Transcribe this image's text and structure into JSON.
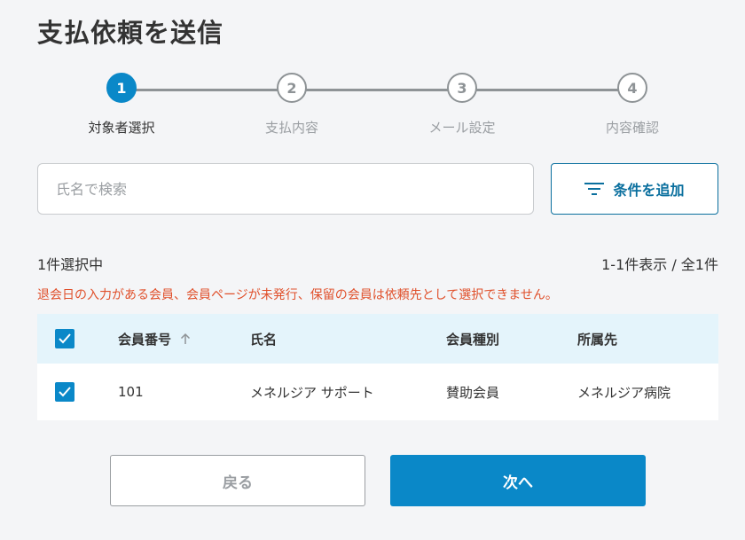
{
  "header": {
    "title": "支払依頼を送信"
  },
  "stepper": {
    "steps": [
      {
        "number": "1",
        "label": "対象者選択",
        "active": true
      },
      {
        "number": "2",
        "label": "支払内容",
        "active": false
      },
      {
        "number": "3",
        "label": "メール設定",
        "active": false
      },
      {
        "number": "4",
        "label": "内容確認",
        "active": false
      }
    ]
  },
  "search": {
    "placeholder": "氏名で検索",
    "value": ""
  },
  "filter": {
    "label": "条件を追加",
    "icon": "filter-icon"
  },
  "summary": {
    "selected": "1件選択中",
    "range": "1-1件表示 / 全1件"
  },
  "warning": "退会日の入力がある会員、会員ページが未発行、保留の会員は依頼先として選択できません。",
  "table": {
    "columns": [
      "会員番号",
      "氏名",
      "会員種別",
      "所属先"
    ],
    "sort_icon": "arrow-up-icon",
    "header_checked": true,
    "rows": [
      {
        "checked": true,
        "number": "101",
        "name": "メネルジア サポート",
        "type": "賛助会員",
        "org": "メネルジア病院"
      }
    ]
  },
  "actions": {
    "back_label": "戻る",
    "next_label": "次へ"
  },
  "colors": {
    "accent": "#0a88c8",
    "warning": "#e0502b",
    "header_bg": "#e4f4fb"
  }
}
